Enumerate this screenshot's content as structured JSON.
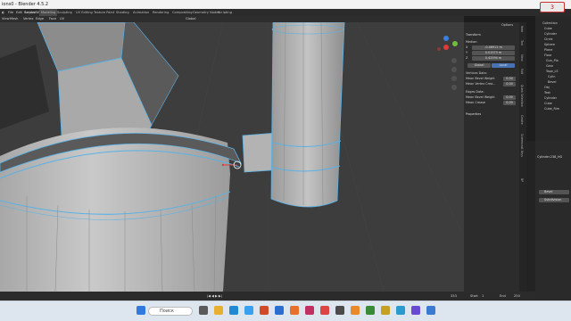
{
  "title_bar": {
    "title": "ions0 - Blender 4.5.2",
    "recording_label": "3"
  },
  "menu_bar": {
    "items": [
      "File",
      "Edit",
      "Render",
      "Window",
      "Help"
    ],
    "workspaces": [
      "Layout",
      "Modeling",
      "Sculpting",
      "UV Editing",
      "Texture Paint",
      "Shading",
      "Animation",
      "Rendering",
      "Compositing",
      "Geometry Nodes",
      "Scripting"
    ],
    "active_workspace": "Modeling"
  },
  "header_bar": {
    "mode": "Edit Mode",
    "items": [
      "View",
      "Select",
      "Add",
      "Mesh",
      "Vertex",
      "Edge",
      "Face",
      "UV"
    ],
    "orientation": "Global"
  },
  "npanel": {
    "options_label": "Options",
    "transform_header": "Transform",
    "median_label": "Median:",
    "x_label": "X",
    "x_value": "-0.46911 m",
    "y_label": "Y",
    "y_value": "0.01573 m",
    "z_label": "Z",
    "z_value": "0.42594 m",
    "global_label": "Global",
    "local_label": "Local",
    "vertices_data_header": "Vertices Data:",
    "mean_bevel_weight_label": "Mean Bevel Weight",
    "mean_bevel_weight_value": "0.00",
    "mean_vertex_crease_label": "Mean Vertex Crea...",
    "mean_vertex_crease_value": "0.00",
    "edges_data_header": "Edges Data:",
    "edge_bevel_weight_label": "Mean Bevel Weight",
    "edge_bevel_weight_value": "0.00",
    "mean_crease_label": "Mean Crease",
    "mean_crease_value": "0.00",
    "properties_header": "Properties"
  },
  "sidebar_tabs": [
    "Item",
    "Tool",
    "View",
    "Edit",
    "Quick Selection",
    "Create",
    "Screencast Keys",
    "BP"
  ],
  "outliner": {
    "rows": [
      "Collection",
      "Cube",
      "Cylinder",
      "Circle",
      "Sphere",
      "Plane",
      "Floor",
      "Gun_Pla",
      "Gear",
      "Tape_LS",
      "Cylin",
      "Bevel",
      "Obj",
      "Text",
      "Cylinder",
      "Cube",
      "Cube_Rim"
    ]
  },
  "properties": {
    "object_name": "Cylinder.238_HG",
    "modifiers": [
      "Bevel",
      "Subdivision"
    ]
  },
  "timeline": {
    "start_label": "Start",
    "start_value": "1",
    "end_label": "End",
    "end_value": "250",
    "current_frame": "333"
  },
  "taskbar": {
    "search_placeholder": "Поиск"
  },
  "colors": {
    "accent": "#4772b3",
    "edge_highlight": "#59b2e6",
    "viewport": "#3d3d3d"
  }
}
